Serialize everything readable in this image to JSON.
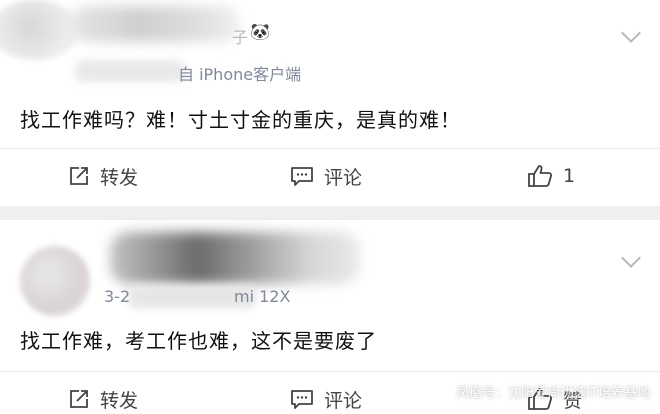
{
  "comments": [
    {
      "source_suffix": "自 iPhone客户端",
      "name_suffix": "子",
      "emoji": "🐼",
      "text": "找工作难吗？难！寸土寸金的重庆，是真的难！",
      "actions": {
        "repost": "转发",
        "comment": "评论",
        "like_count": "1"
      }
    },
    {
      "date_prefix": "3-2",
      "source_suffix": "mi 12X",
      "text": "找工作难，考工作也难，这不是要废了",
      "actions": {
        "repost": "转发",
        "comment": "评论",
        "like_label": "赞"
      }
    }
  ],
  "watermark": "凤凰号：沈阳爱尚优选IT培养基地",
  "icons": {
    "repost": "share-icon",
    "comment": "comment-icon",
    "like": "thumbs-up-icon",
    "expand": "chevron-down-icon"
  },
  "colors": {
    "text": "#111111",
    "meta": "#7e8a9b",
    "divider": "#efefef"
  }
}
